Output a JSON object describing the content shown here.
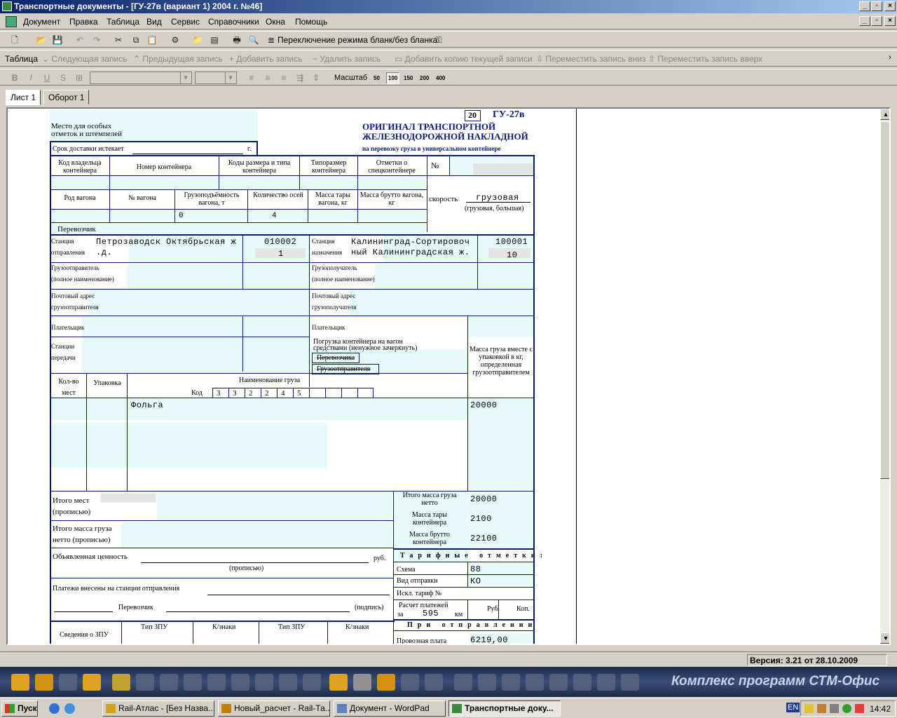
{
  "window": {
    "title": "Транспортные документы - [ГУ-27в (вариант 1) 2004 г. №46]"
  },
  "menu": [
    "Документ",
    "Правка",
    "Таблица",
    "Вид",
    "Сервис",
    "Справочники",
    "Окна",
    "Помощь"
  ],
  "toolbar1": {
    "mode_label": "Переключение режима бланк/без бланка"
  },
  "toolbar2": {
    "label": "Таблица",
    "next": "Следующая запись",
    "prev": "Предыдущая запись",
    "add": "Добавить запись",
    "delete": "Удалить запись",
    "add_copy": "Добавить копию текущей записи",
    "move_down": "Переместить запись вниз",
    "move_up": "Переместить запись вверх"
  },
  "toolbar3": {
    "scale_label": "Масштаб",
    "scales": [
      "50",
      "100",
      "150",
      "200",
      "400"
    ]
  },
  "tabs": [
    "Лист 1",
    "Оборот 1"
  ],
  "form": {
    "corner_num": "20",
    "code": "ГУ-27в",
    "special_marks": "Место для особых отметок и штемпелей",
    "delivery_expires": "Срок доставки истекает",
    "delivery_g": "г.",
    "title1": "ОРИГИНАЛ ТРАНСПОРТНОЙ",
    "title2": "ЖЕЛЕЗНОДОРОЖНОЙ НАКЛАДНОЙ",
    "title3": "на перевозку груза в универсальном контейнере",
    "h_owner": "Код владельца контейнера",
    "h_cont_num": "Номер контейнера",
    "h_size_codes": "Коды размера и типа контейнера",
    "h_type_size": "Типоразмер контейнера",
    "h_spec": "Отметки о спецконтейнере",
    "h_no": "№",
    "h_wagon_kind": "Род вагона",
    "h_wagon_no": "№ вагона",
    "h_capacity": "Грузоподъёмность вагона, т",
    "h_axles": "Количество осей",
    "h_tare": "Масса тары вагона, кг",
    "h_gross": "Масса брутто вагона, кг",
    "speed_label": "скорость",
    "speed_value": "грузовая",
    "speed_hint": "(грузовая, большая)",
    "capacity_val": "0",
    "axles_val": "4",
    "carrier": "Перевозчик",
    "dep_station_lbl1": "Станция",
    "dep_station_lbl2": "отправления",
    "dep_station": "Петрозаводск Октябрьская ж",
    "dep_station2": ".д.",
    "dep_code": "010002",
    "dep_sub": "1",
    "dest_station_lbl1": "Станция",
    "dest_station_lbl2": "назначения",
    "dest_station": "Калининград-Сортировоч",
    "dest_station2": "ный Калининградская ж.",
    "dest_code": "100001",
    "dest_sub": "10",
    "shipper1": "Грузоотправитель",
    "shipper2": "(полное наименование)",
    "consignee1": "Грузополучатель",
    "consignee2": "(полное наименование)",
    "shipper_addr1": "Почтовый адрес",
    "shipper_addr2": "грузоотправителя",
    "consignee_addr1": "Почтовый адрес",
    "consignee_addr2": "грузополучателя",
    "payer": "Плательщик",
    "payer2": "Плательщик",
    "transfer1": "Станции",
    "transfer2": "передачи",
    "loading1": "Погрузка контейнера на вагон",
    "loading2": "средствами (ненужное зачеркнуть)",
    "by_carrier": "Перевозчика",
    "by_shipper": "Грузоотправителя",
    "mass_header": "Масса груза вместе с упаковкой в кг, определенная грузоотправителем",
    "h_places": "Кол-во мест",
    "h_pack": "Упаковка",
    "h_cargo_name": "Наименование груза",
    "h_code": "Код",
    "code_digits": [
      "3",
      "3",
      "2",
      "2",
      "4",
      "5",
      "",
      "",
      "",
      ""
    ],
    "cargo_name": "Фольга",
    "cargo_mass": "20000",
    "total_places1": "Итого мест",
    "total_places2": "(прописью)",
    "total_mass1": "Итого масса груза",
    "total_mass2": "нетто (прописью)",
    "declared": "Объявленная ценность",
    "rub": "руб.",
    "in_words": "(прописью)",
    "net_lbl": "Итого масса груза нетто",
    "net_val": "20000",
    "tare_lbl": "Масса тары контейнера",
    "tare_val": "2100",
    "gross_lbl": "Масса брутто контейнера",
    "gross_val": "22100",
    "tariff_header": "Тарифные отметки:",
    "scheme_lbl": "Схема",
    "scheme_val": "88",
    "dispatch_lbl": "Вид отправки",
    "dispatch_val": "КО",
    "excl_tariff": "Искл. тариф №",
    "calc1": "Расчет платежей",
    "calc_for": "за",
    "km_val": "595",
    "km": "км",
    "rub_h": "Руб.",
    "kop_h": "Коп.",
    "on_dispatch": "При отправлении",
    "freight_lbl": "Провозная плата",
    "freight_val": "6219,00",
    "payments": "Платежи внесены на станции отправления",
    "carrier2": "Перевозчик",
    "signature": "(подпись)",
    "zpu_info": "Сведения о ЗПУ",
    "zpu_type": "Тип ЗПУ",
    "zpu_marks": "К/знаки",
    "zpu_type2": "Тип ЗПУ",
    "zpu_marks2": "К/знаки"
  },
  "status": {
    "version": "Версия: 3.21 от 28.10.2009"
  },
  "appbar": {
    "brand": "Комплекс программ СТМ-Офис"
  },
  "taskbar": {
    "start": "Пуск",
    "tasks": [
      "Rail-Атлас - [Без Назва...",
      "Новый_расчет - Rail-Та...",
      "Документ - WordPad",
      "Транспортные доку..."
    ],
    "lang": "EN",
    "clock": "14:42"
  }
}
